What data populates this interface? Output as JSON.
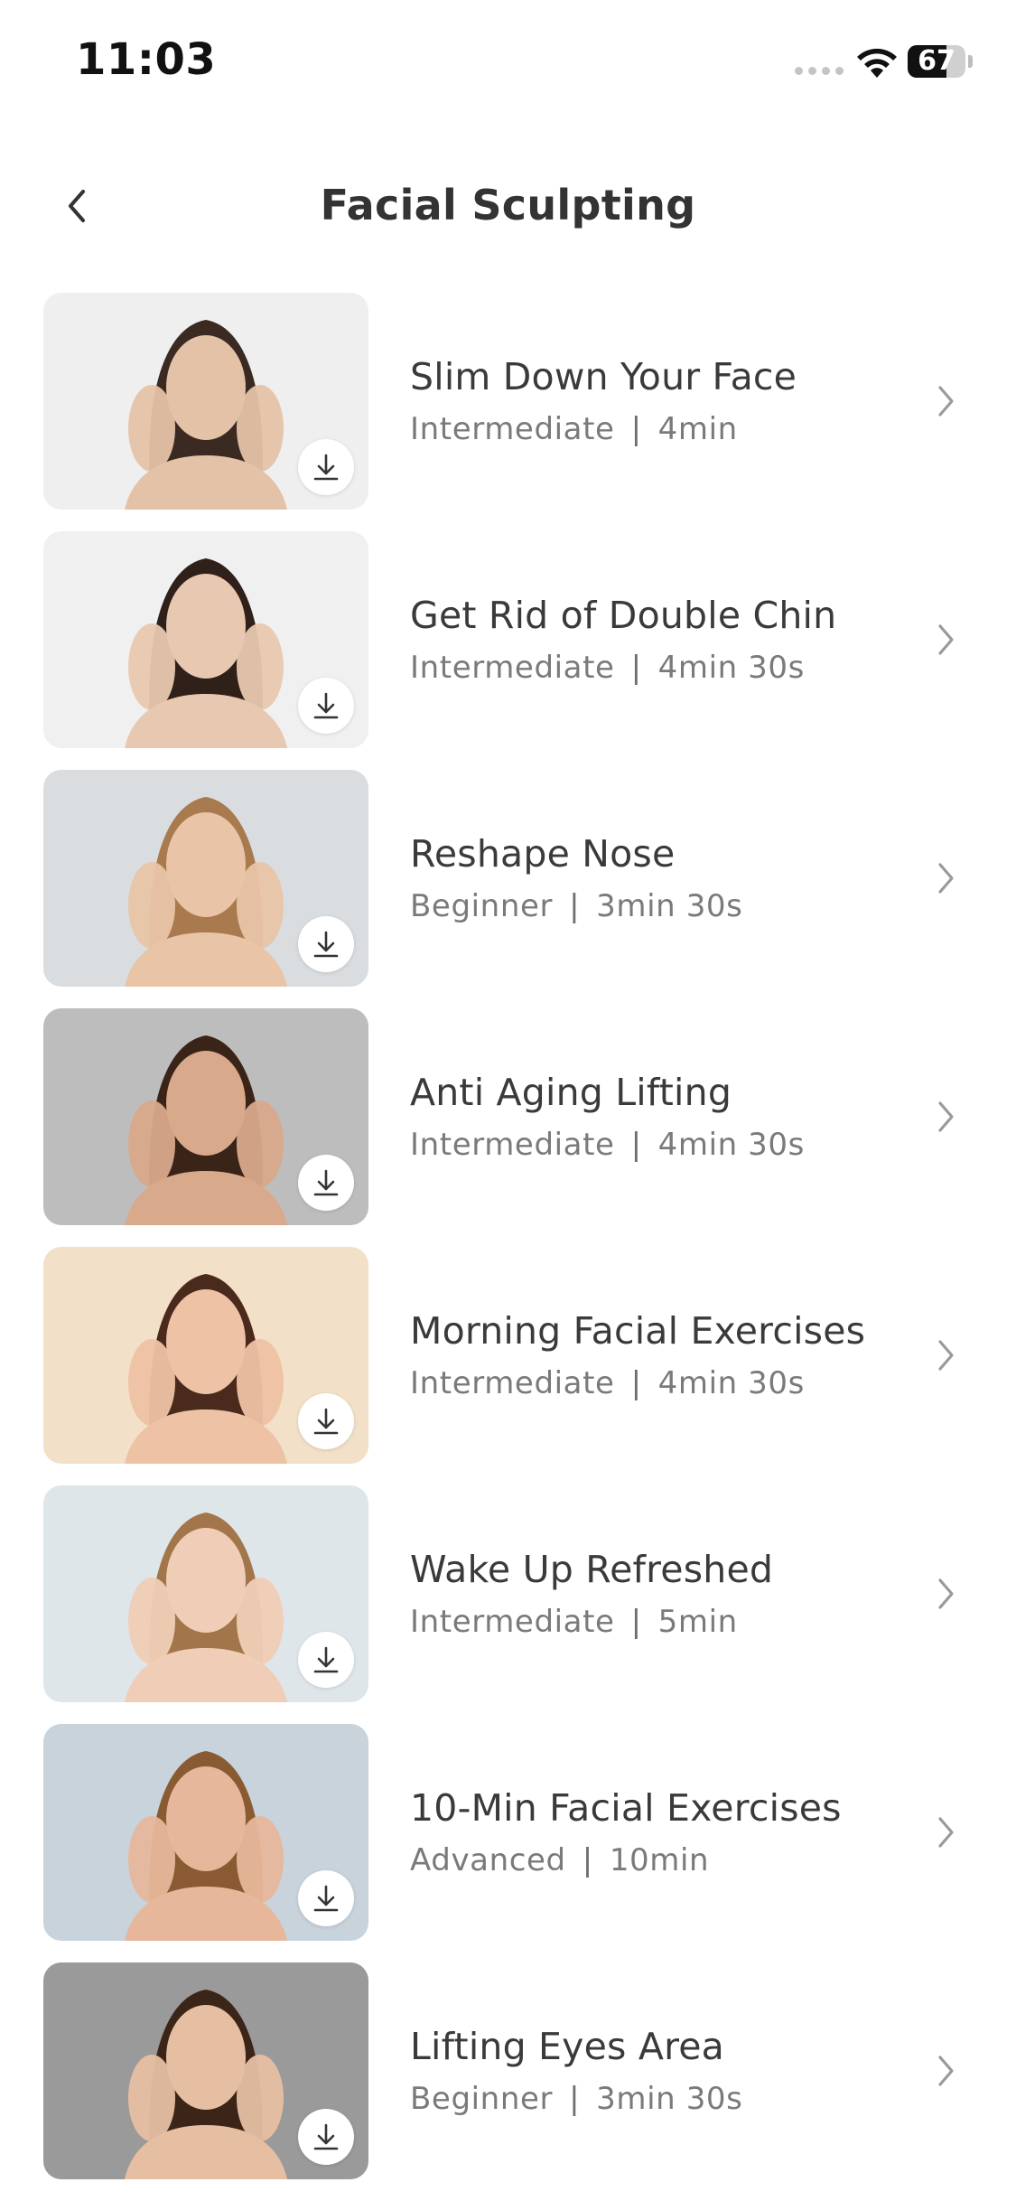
{
  "status_bar": {
    "time": "11:03",
    "battery_level": "67",
    "battery_fraction": 0.67
  },
  "header": {
    "title": "Facial Sculpting",
    "back_icon": "chevron-left-icon"
  },
  "list": {
    "items": [
      {
        "title": "Slim Down Your Face",
        "level": "Intermediate",
        "duration": "4min",
        "thumb_bg": "#efefef",
        "thumb_accent": "#e4c2a8",
        "hair": "#3b2a22"
      },
      {
        "title": "Get Rid of Double Chin",
        "level": "Intermediate",
        "duration": "4min 30s",
        "thumb_bg": "#f0f0f0",
        "thumb_accent": "#e8c8b0",
        "hair": "#2f2019"
      },
      {
        "title": "Reshape Nose",
        "level": "Beginner",
        "duration": "3min 30s",
        "thumb_bg": "#d9dde0",
        "thumb_accent": "#e9c4a6",
        "hair": "#a87a4e"
      },
      {
        "title": "Anti Aging Lifting",
        "level": "Intermediate",
        "duration": "4min 30s",
        "thumb_bg": "#bdbdbd",
        "thumb_accent": "#d8a98a",
        "hair": "#3a2418"
      },
      {
        "title": "Morning Facial Exercises",
        "level": "Intermediate",
        "duration": "4min 30s",
        "thumb_bg": "#f2e0c8",
        "thumb_accent": "#eec2a4",
        "hair": "#4a2a1c"
      },
      {
        "title": "Wake Up Refreshed",
        "level": "Intermediate",
        "duration": "5min",
        "thumb_bg": "#dfe6ea",
        "thumb_accent": "#f0cdb6",
        "hair": "#a2764a"
      },
      {
        "title": "10-Min Facial Exercises",
        "level": "Advanced",
        "duration": "10min",
        "thumb_bg": "#c8d3dc",
        "thumb_accent": "#e7b79b",
        "hair": "#8a5a32"
      },
      {
        "title": "Lifting Eyes Area",
        "level": "Beginner",
        "duration": "3min 30s",
        "thumb_bg": "#9a9a9a",
        "thumb_accent": "#e6bfa2",
        "hair": "#3b2519"
      }
    ]
  },
  "colors": {
    "title_text": "#3a3a3a",
    "meta_text": "#7a7a7a",
    "chevron": "#9a9a9a"
  }
}
